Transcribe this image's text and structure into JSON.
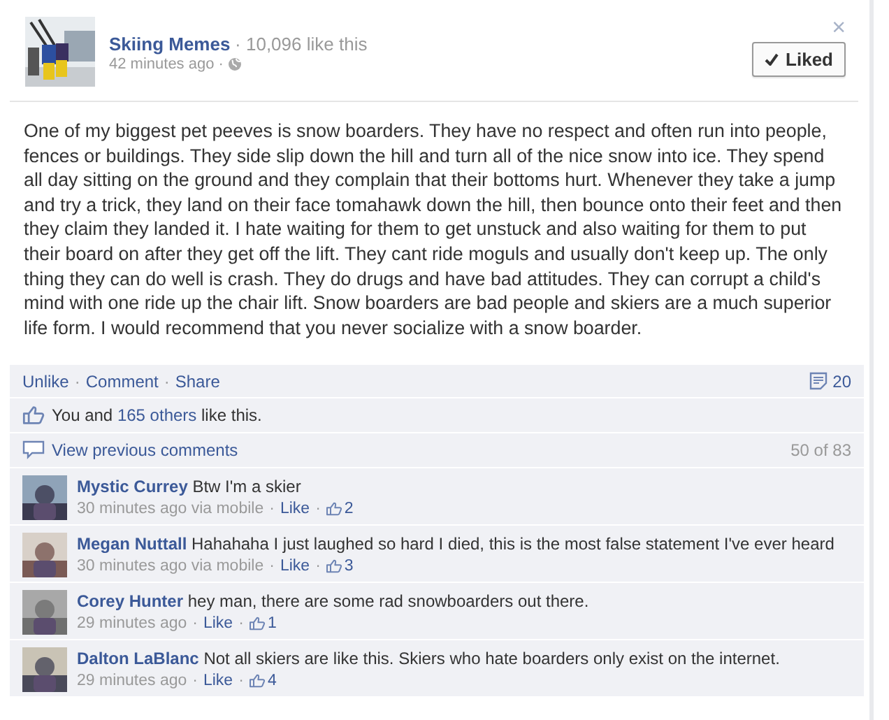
{
  "page": {
    "name": "Skiing Memes",
    "likes": "· 10,096 like this",
    "time": "42 minutes ago ·",
    "liked_button": "Liked",
    "close": "×"
  },
  "post": {
    "text": "One of my biggest pet peeves is snow boarders. They have no respect and often run into people, fences or buildings. They side slip down the hill and turn all of the nice snow into ice. They spend all day sitting on the ground and they complain that their bottoms hurt. Whenever they take a jump and try a trick, they land on their face tomahawk down the hill, then bounce onto their feet and then they claim they landed it. I hate waiting for them to get unstuck and also waiting for them to put their board on after they get off the lift. They cant ride moguls and usually don't keep up. The only thing they can do well is crash. They do drugs and have bad attitudes. They can corrupt a child's mind with one ride up the chair lift. Snow boarders are bad people and skiers are a much superior life form. I would recommend that you never socialize with a snow boarder."
  },
  "separator": "·",
  "actions": [
    "Unlike",
    "Comment",
    "Share"
  ],
  "comment_count": "20",
  "likes_line": {
    "prefix": "You and",
    "link": "165 others",
    "suffix": "like this."
  },
  "previous": {
    "label": "View previous comments",
    "count": "50 of 83"
  },
  "comments": [
    {
      "name": "Mystic Currey",
      "text": "Btw I'm a skier",
      "time": "30 minutes ago via mobile",
      "like": "Like",
      "likes": "2"
    },
    {
      "name": "Megan Nuttall",
      "text": "Hahahaha I just laughed so hard I died, this is the most false statement I've ever heard",
      "time": "30 minutes ago via mobile",
      "like": "Like",
      "likes": "3"
    },
    {
      "name": "Corey Hunter",
      "text": "hey man, there are some rad snowboarders out there.",
      "time": "29 minutes ago",
      "like": "Like",
      "likes": "1"
    },
    {
      "name": "Dalton LaBlanc",
      "text": "Not all skiers are like this. Skiers who hate boarders only exist on the internet.",
      "time": "29 minutes ago",
      "like": "Like",
      "likes": "4"
    }
  ]
}
